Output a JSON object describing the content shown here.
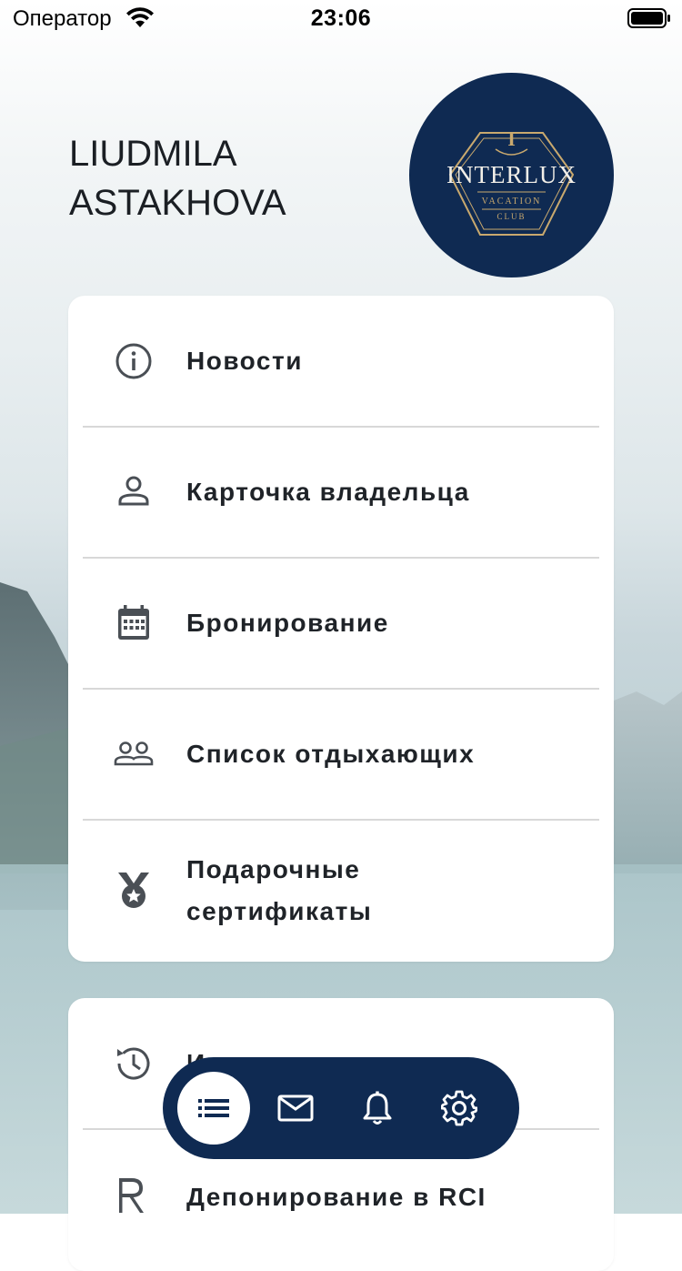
{
  "status_bar": {
    "carrier": "Оператор",
    "time": "23:06"
  },
  "header": {
    "user_name": "LIUDMILA\nASTAKHOVA",
    "logo_icon": "interlux-logo-icon",
    "logo_text": "INTERLUX",
    "logo_subtext_1": "VACATION",
    "logo_subtext_2": "CLUB"
  },
  "menu_main": [
    {
      "icon": "info-icon",
      "label": "Новости"
    },
    {
      "icon": "person-icon",
      "label": "Карточка владельца"
    },
    {
      "icon": "calendar-icon",
      "label": "Бронирование"
    },
    {
      "icon": "people-icon",
      "label": "Список отдыхающих"
    },
    {
      "icon": "medal-icon",
      "label": "Подарочные сертификаты"
    }
  ],
  "menu_secondary": [
    {
      "icon": "history-icon",
      "label": "И"
    },
    {
      "icon": "rci-icon",
      "label": "Депонирование в RCI"
    }
  ],
  "bottom_nav": [
    {
      "icon": "list-icon",
      "active": true
    },
    {
      "icon": "mail-icon",
      "active": false
    },
    {
      "icon": "bell-icon",
      "active": false
    },
    {
      "icon": "settings-icon",
      "active": false
    }
  ],
  "colors": {
    "brand_navy": "#0f2a52",
    "logo_gold": "#c9a96e",
    "text_dark": "#1f2328",
    "divider": "#d8d8d8"
  }
}
